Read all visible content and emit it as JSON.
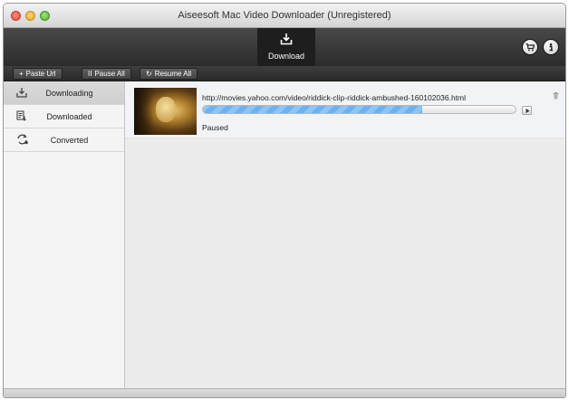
{
  "window": {
    "title": "Aiseesoft Mac Video Downloader (Unregistered)"
  },
  "toolbar": {
    "download_tab": "Download",
    "cart_icon": "cart-icon",
    "info_icon": "info-icon"
  },
  "actions": {
    "paste": "Paste Url",
    "pause": "Pause All",
    "resume": "Resume All"
  },
  "sidebar": {
    "items": [
      {
        "label": "Downloading",
        "icon": "download-tray-icon",
        "active": true
      },
      {
        "label": "Downloaded",
        "icon": "downloaded-list-icon",
        "active": false
      },
      {
        "label": "Converted",
        "icon": "convert-arrows-icon",
        "active": false
      }
    ]
  },
  "tasks": [
    {
      "url": "http://movies.yahoo.com/video/riddick-clip-riddick-ambushed-160102036.html",
      "status": "Paused",
      "progress": 0.7
    }
  ]
}
